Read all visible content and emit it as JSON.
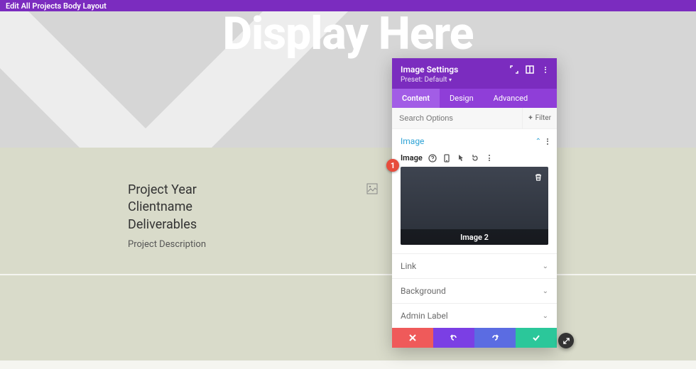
{
  "topbar": {
    "title": "Edit All Projects Body Layout"
  },
  "hero": {
    "title": "Display Here"
  },
  "project": {
    "line1": "Project Year",
    "line2": "Clientname",
    "line3": "Deliverables",
    "desc": "Project Description"
  },
  "badge": {
    "number": "1"
  },
  "modal": {
    "title": "Image Settings",
    "preset": "Preset: Default",
    "tabs": {
      "content": "Content",
      "design": "Design",
      "advanced": "Advanced",
      "active": "content"
    },
    "search": {
      "placeholder": "Search Options",
      "filter": "Filter"
    },
    "sections": {
      "image": {
        "title": "Image",
        "field_label": "Image",
        "upload_label": "Image 2"
      },
      "link": {
        "title": "Link"
      },
      "background": {
        "title": "Background"
      },
      "admin_label": {
        "title": "Admin Label"
      }
    }
  },
  "colors": {
    "brand": "#7b2cbf"
  }
}
